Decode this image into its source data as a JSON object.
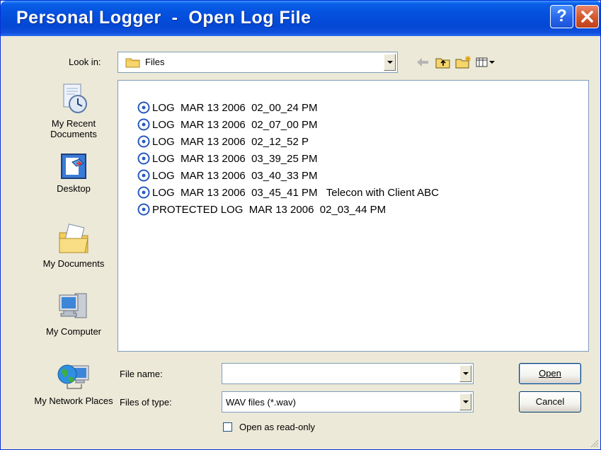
{
  "window": {
    "title": "Personal Logger  -  Open Log File",
    "help_label": "?"
  },
  "lookin": {
    "label": "Look in:",
    "value": "Files"
  },
  "places": [
    {
      "label": "My Recent Documents",
      "icon": "recent-documents-icon"
    },
    {
      "label": "Desktop",
      "icon": "desktop-icon"
    },
    {
      "label": "My Documents",
      "icon": "my-documents-icon"
    },
    {
      "label": "My Computer",
      "icon": "my-computer-icon"
    },
    {
      "label": "My Network Places",
      "icon": "network-places-icon"
    }
  ],
  "files": [
    "LOG  MAR 13 2006  02_00_24 PM",
    "LOG  MAR 13 2006  02_07_00 PM",
    "LOG  MAR 13 2006  02_12_52 P",
    "LOG  MAR 13 2006  03_39_25 PM",
    "LOG  MAR 13 2006  03_40_33 PM",
    "LOG  MAR 13 2006  03_45_41 PM   Telecon with Client ABC",
    "PROTECTED LOG  MAR 13 2006  02_03_44 PM"
  ],
  "filename": {
    "label": "File name:",
    "value": ""
  },
  "filetype": {
    "label": "Files of type:",
    "value": "WAV files (*.wav)"
  },
  "buttons": {
    "open": "Open",
    "cancel": "Cancel"
  },
  "readonly": {
    "label": "Open as read-only",
    "checked": false
  }
}
